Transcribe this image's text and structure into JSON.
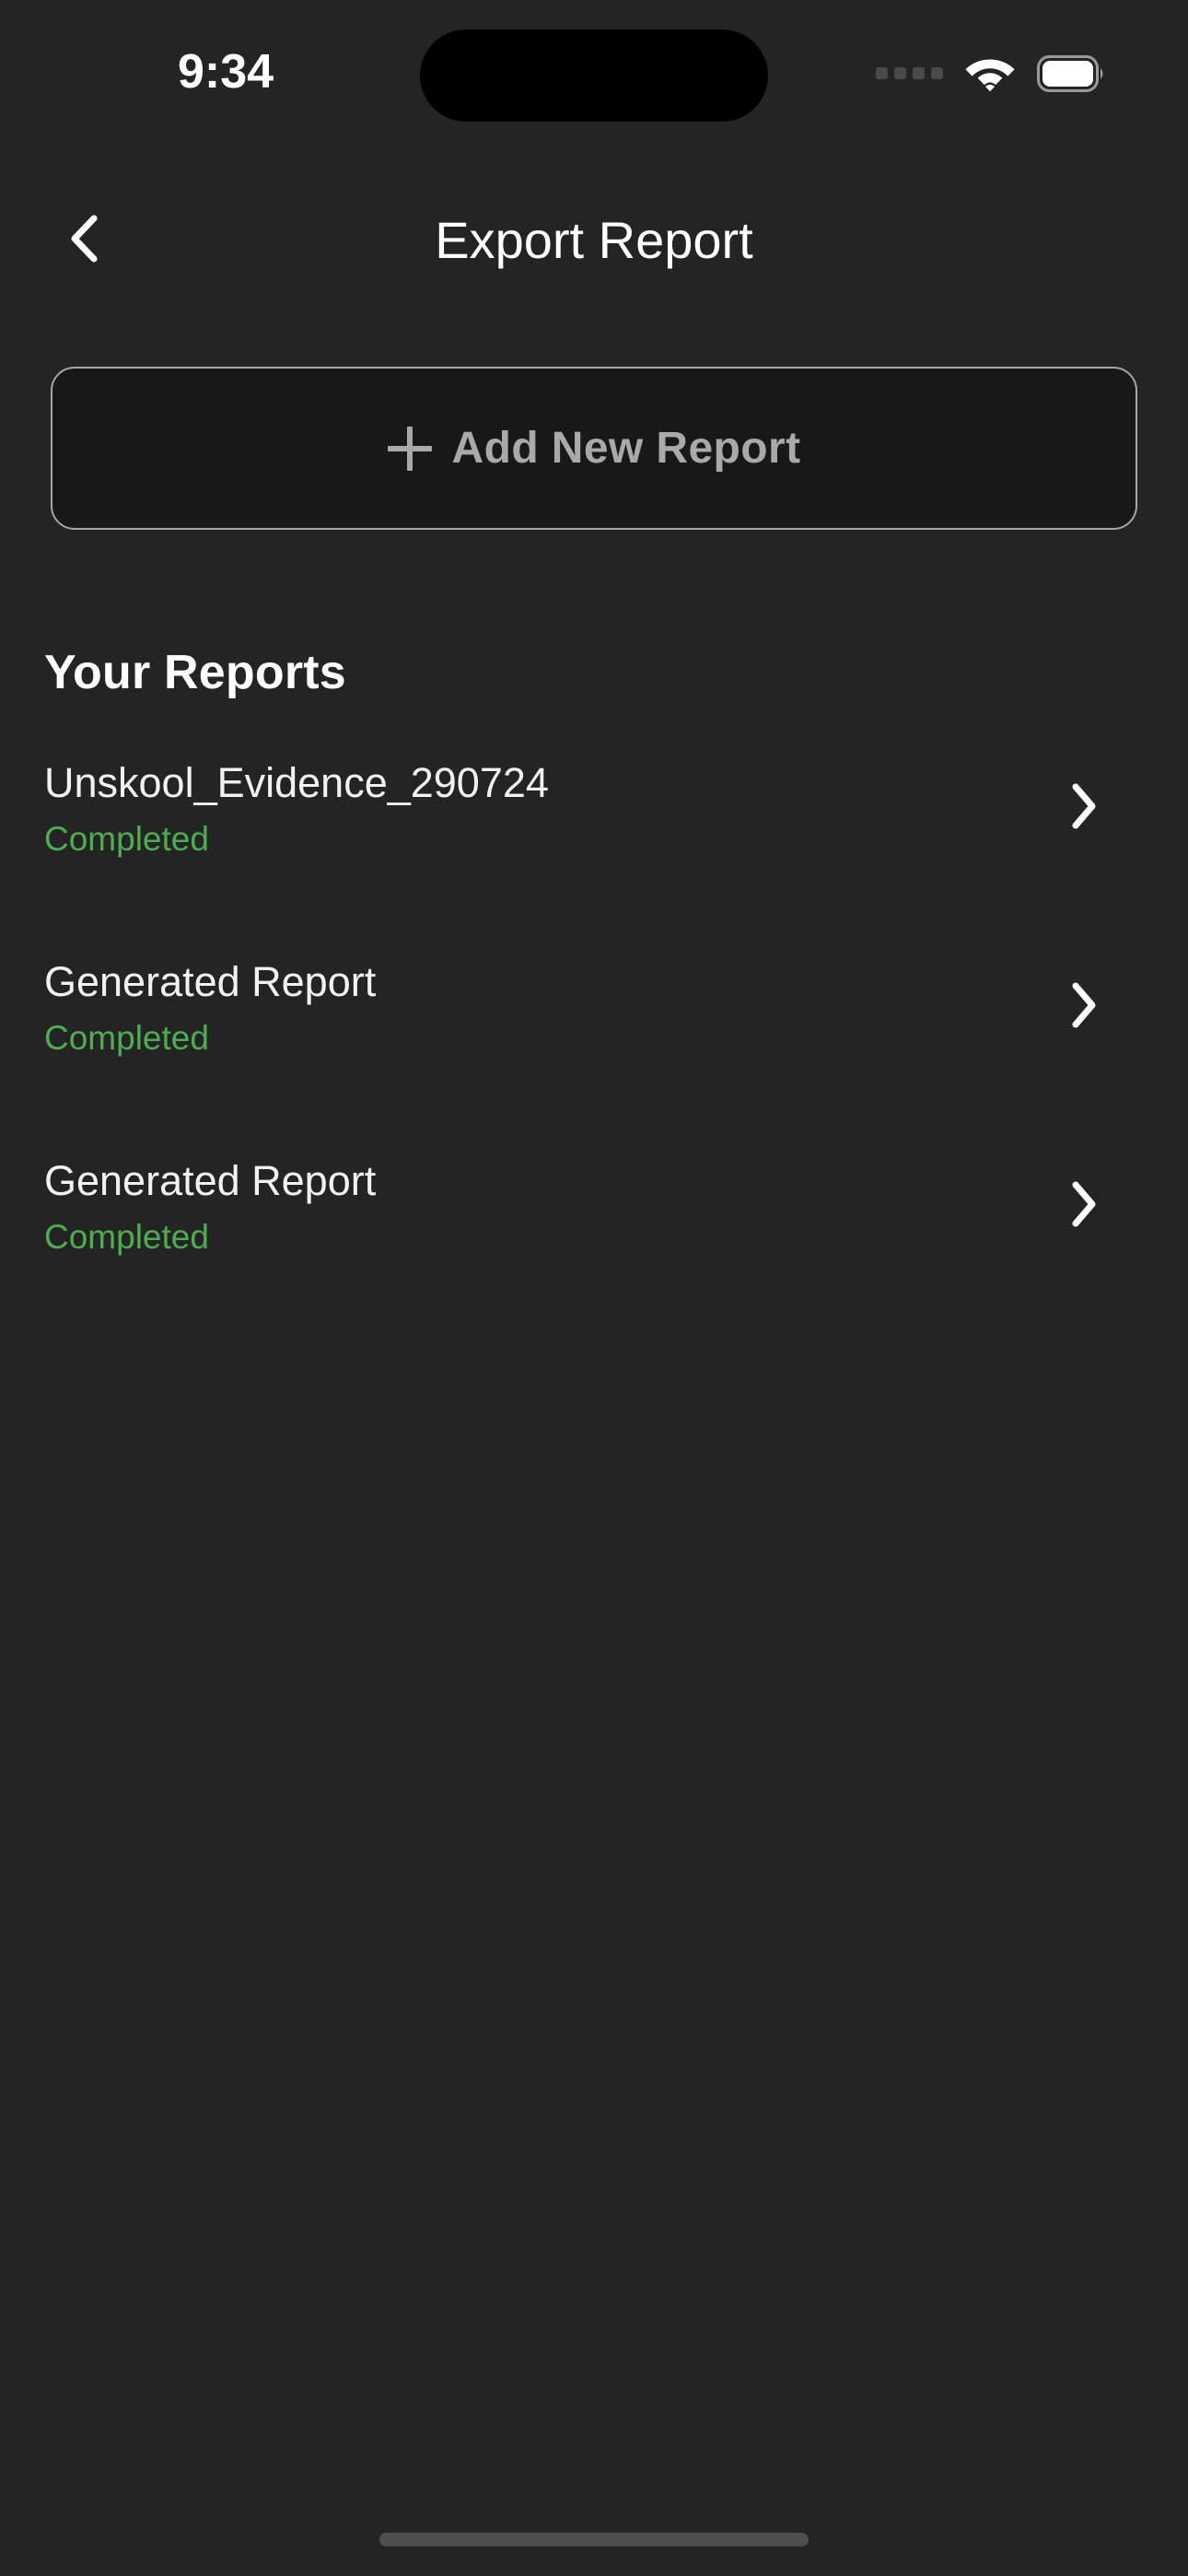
{
  "status_bar": {
    "time": "9:34",
    "signal_icon": "signal-dots-icon",
    "wifi_icon": "wifi-icon",
    "battery_icon": "battery-full-icon"
  },
  "header": {
    "back_icon": "chevron-left-icon",
    "title": "Export Report"
  },
  "add_report": {
    "icon": "plus-icon",
    "label": "Add New Report"
  },
  "reports_section": {
    "heading": "Your Reports",
    "items": [
      {
        "name": "Unskool_Evidence_290724",
        "status": "Completed",
        "chevron_icon": "chevron-right-icon"
      },
      {
        "name": "Generated Report",
        "status": "Completed",
        "chevron_icon": "chevron-right-icon"
      },
      {
        "name": "Generated Report",
        "status": "Completed",
        "chevron_icon": "chevron-right-icon"
      }
    ]
  },
  "colors": {
    "background": "#242424",
    "card_background": "#181818",
    "border": "#a6a6a6",
    "text_primary": "#f2f2f2",
    "text_muted": "#a9a9a9",
    "status_completed": "#4cae50",
    "home_indicator": "#4e4e4e"
  }
}
